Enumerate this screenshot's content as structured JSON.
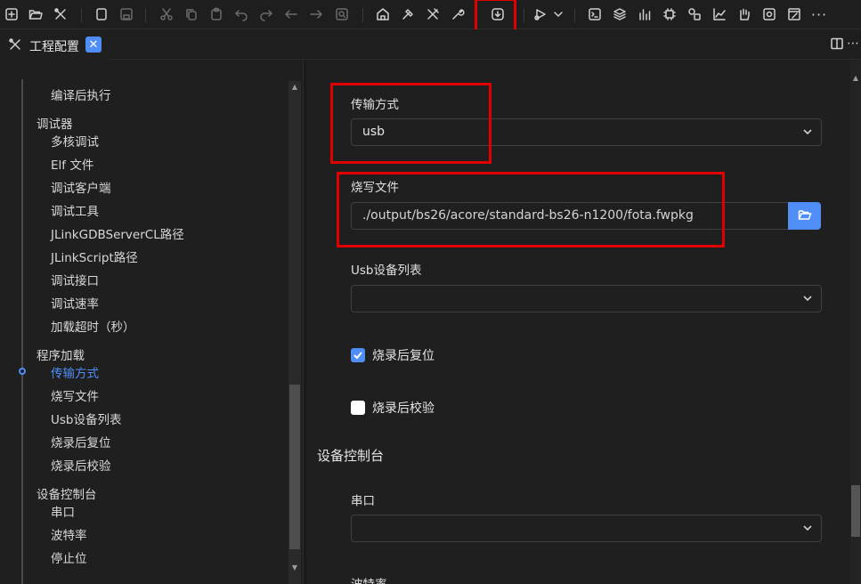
{
  "toolbar": {
    "icons": [
      "new-project-icon",
      "open-folder-icon",
      "tools-icon",
      "new-file-icon",
      "save-icon",
      "cut-icon",
      "copy-icon",
      "paste-icon",
      "undo-icon",
      "redo-icon",
      "back-icon",
      "forward-icon",
      "find-icon",
      "build-house-icon",
      "hammer-icon",
      "crossed-tools-icon",
      "wrench-icon",
      "download-flash-icon",
      "debug-run-icon",
      "dropdown-chevron-icon",
      "terminal-icon",
      "layers-icon",
      "bar-chart-icon",
      "chip-icon",
      "peripheral-icon",
      "line-chart-icon",
      "hand-icon",
      "settings-panel-icon",
      "edit-window-icon",
      "more-icon"
    ]
  },
  "tab": {
    "title": "工程配置",
    "close": "✕"
  },
  "sidebar": {
    "items": [
      {
        "label": "编译后执行",
        "level": "child"
      },
      {
        "label": "调试器",
        "level": "parent"
      },
      {
        "label": "多核调试",
        "level": "child"
      },
      {
        "label": "Elf 文件",
        "level": "child"
      },
      {
        "label": "调试客户端",
        "level": "child"
      },
      {
        "label": "调试工具",
        "level": "child"
      },
      {
        "label": "JLinkGDBServerCL路径",
        "level": "child"
      },
      {
        "label": "JLinkScript路径",
        "level": "child"
      },
      {
        "label": "调试接口",
        "level": "child"
      },
      {
        "label": "调试速率",
        "level": "child"
      },
      {
        "label": "加载超时（秒）",
        "level": "child"
      },
      {
        "label": "程序加载",
        "level": "parent"
      },
      {
        "label": "传输方式",
        "level": "child",
        "active": true
      },
      {
        "label": "烧写文件",
        "level": "child"
      },
      {
        "label": "Usb设备列表",
        "level": "child"
      },
      {
        "label": "烧录后复位",
        "level": "child"
      },
      {
        "label": "烧录后校验",
        "level": "child"
      },
      {
        "label": "设备控制台",
        "level": "parent"
      },
      {
        "label": "串口",
        "level": "child"
      },
      {
        "label": "波特率",
        "level": "child"
      },
      {
        "label": "停止位",
        "level": "child"
      }
    ]
  },
  "form": {
    "transfer_label": "传输方式",
    "transfer_value": "usb",
    "burn_file_label": "烧写文件",
    "burn_file_value": "./output/bs26/acore/standard-bs26-n1200/fota.fwpkg",
    "usb_list_label": "Usb设备列表",
    "usb_list_value": "",
    "reset_after_burn_label": "烧录后复位",
    "reset_after_burn_checked": true,
    "verify_after_burn_label": "烧录后校验",
    "verify_after_burn_checked": false,
    "console_section": "设备控制台",
    "serial_label": "串口",
    "serial_value": "",
    "next_label_partial": "波特率"
  },
  "colors": {
    "accent": "#4f8ef7",
    "highlight": "#e00000",
    "background": "#1f1f1f"
  }
}
